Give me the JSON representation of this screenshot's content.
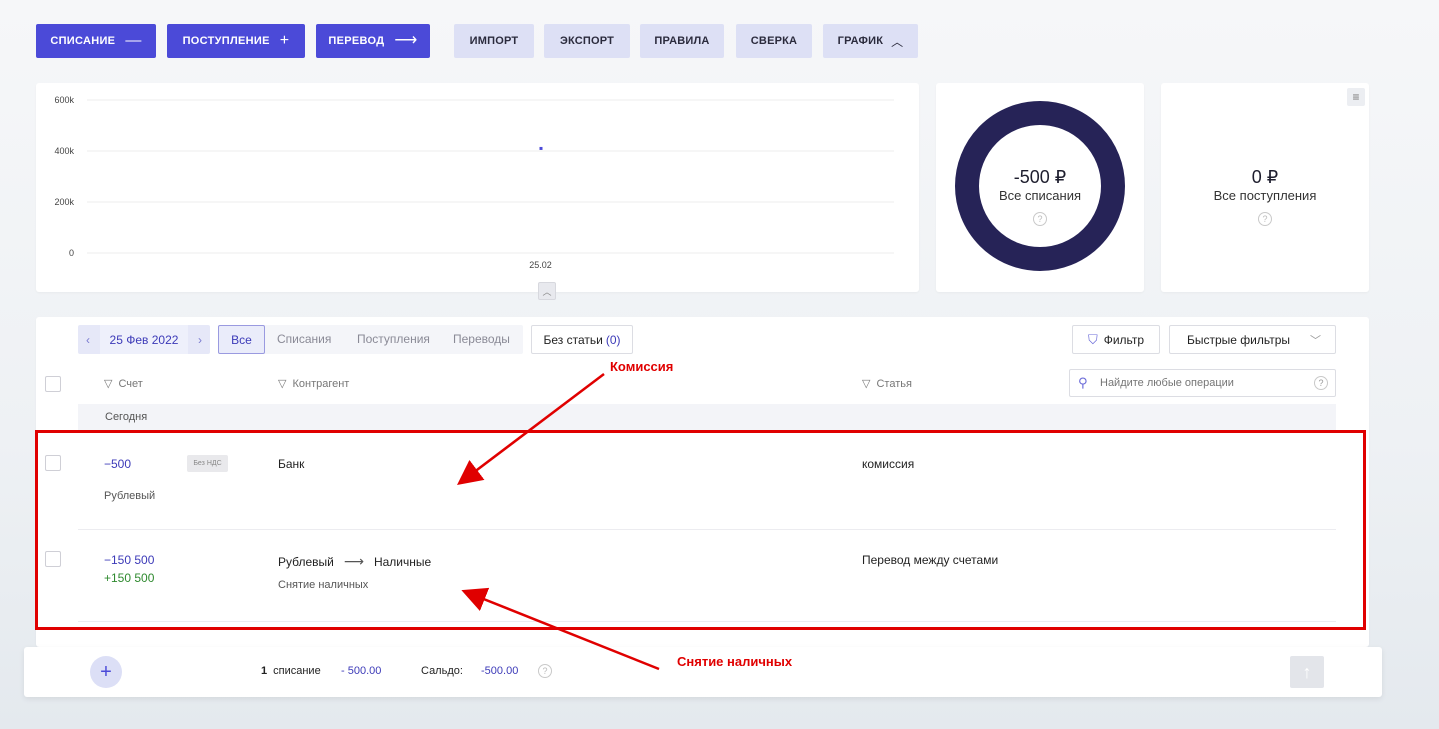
{
  "toolbar": {
    "writeoff_label": "СПИСАНИЕ",
    "income_label": "ПОСТУПЛЕНИЕ",
    "transfer_label": "ПЕРЕВОД",
    "import_label": "ИМПОРТ",
    "export_label": "ЭКСПОРТ",
    "rules_label": "ПРАВИЛА",
    "reconcile_label": "СВЕРКА",
    "chart_label": "ГРАФИК"
  },
  "chart_data": {
    "type": "scatter",
    "categories": [
      "25.02"
    ],
    "yticks": [
      "600k",
      "400k",
      "200k",
      "0"
    ],
    "yticks_values": [
      600000,
      400000,
      200000,
      0
    ],
    "ylim": [
      0,
      600000
    ],
    "points": [
      {
        "x": "25.02",
        "y": 410000
      }
    ],
    "grid": true,
    "color": "#4b4ad8"
  },
  "summary": {
    "writeoffs_value": "-500 ₽",
    "writeoffs_label": "Все списания",
    "income_value": "0 ₽",
    "income_label": "Все поступления",
    "help": "?"
  },
  "filters": {
    "date": "25 Фев 2022",
    "all": "Все",
    "writeoffs": "Списания",
    "incomes": "Поступления",
    "transfers": "Переводы",
    "no_article": "Без статьи",
    "no_article_count": "(0)",
    "filter_btn": "Фильтр",
    "quick_filters": "Быстрые фильтры",
    "search_placeholder": "Найдите любые операции"
  },
  "columns": {
    "account": "Счет",
    "counterparty": "Контрагент",
    "article": "Статья"
  },
  "group_label": "Сегодня",
  "rows": [
    {
      "amount": "−500",
      "vat": "Без НДС",
      "account": "Рублевый",
      "counterparty": "Банк",
      "article": "комиссия"
    },
    {
      "amount_out": "−150 500",
      "amount_in": "+150 500",
      "from_account": "Рублевый",
      "to_account": "Наличные",
      "description": "Снятие наличных",
      "article": "Перевод между счетами"
    }
  ],
  "footer": {
    "count": "1",
    "count_label": "списание",
    "sum": "- 500.00",
    "balance_label": "Сальдо:",
    "balance": "-500.00"
  },
  "annotations": {
    "commission": "Комиссия",
    "cash_withdrawal": "Снятие наличных"
  }
}
